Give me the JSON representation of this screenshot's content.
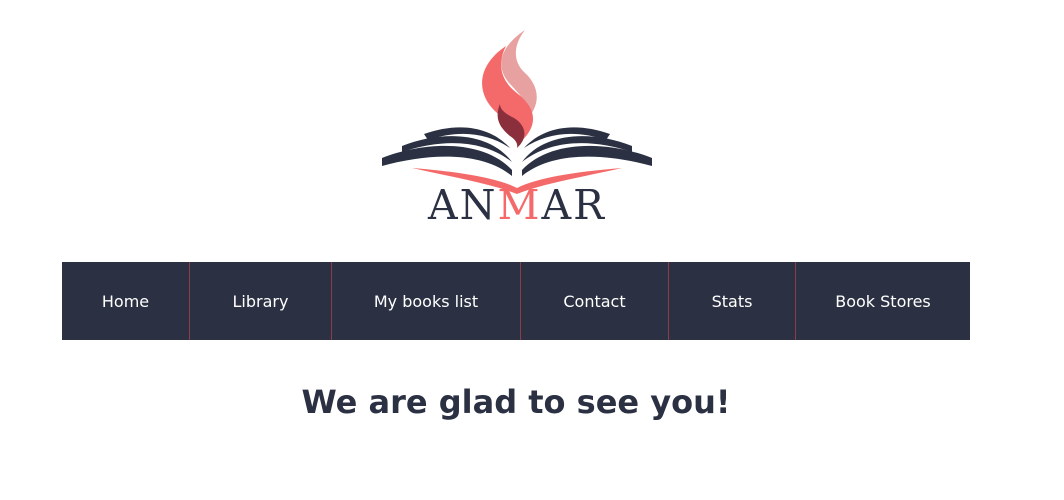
{
  "logo": {
    "icon": "open-book-with-flame-icon",
    "brand_part1": "AN",
    "brand_accent": "M",
    "brand_part2": "AR"
  },
  "colors": {
    "primary": "#2b3142",
    "accent": "#f46a6a",
    "flame_light": "#e8a1a1",
    "flame_dark": "#8a2f3b",
    "divider": "#8c3d4a",
    "nav_text": "#ffffff",
    "background": "#ffffff"
  },
  "nav": {
    "items": [
      {
        "label": "Home"
      },
      {
        "label": "Library"
      },
      {
        "label": "My books list"
      },
      {
        "label": "Contact"
      },
      {
        "label": "Stats"
      },
      {
        "label": "Book Stores"
      }
    ]
  },
  "main": {
    "heading": "We are glad to see you!"
  }
}
